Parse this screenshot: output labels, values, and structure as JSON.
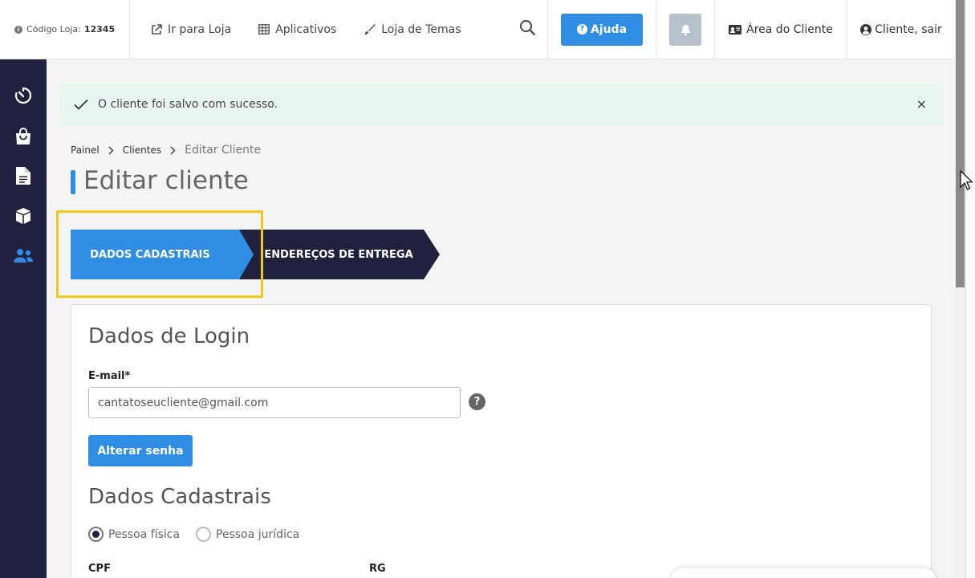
{
  "topbar": {
    "store_code_label": "Código Loja:",
    "store_code_value": "12345",
    "links": [
      {
        "label": "Ir para Loja",
        "icon": "external-link-icon"
      },
      {
        "label": "Aplicativos",
        "icon": "grid-icon"
      },
      {
        "label": "Loja de Temas",
        "icon": "brush-icon"
      }
    ],
    "help_label": "Ajuda",
    "client_area_label": "Área do Cliente",
    "user_label": "Cliente, sair"
  },
  "sidebar": {
    "items": [
      {
        "icon": "dashboard-gauge-icon",
        "active": false
      },
      {
        "icon": "shopping-bag-icon",
        "active": false
      },
      {
        "icon": "document-icon",
        "active": false
      },
      {
        "icon": "box-icon",
        "active": false
      },
      {
        "icon": "users-icon",
        "active": true
      }
    ]
  },
  "alert": {
    "message": "O cliente foi salvo com sucesso.",
    "close": "×"
  },
  "breadcrumb": {
    "items": [
      "Painel",
      "Clientes"
    ],
    "current": "Editar Cliente"
  },
  "page": {
    "title": "Editar cliente"
  },
  "steps": [
    {
      "label": "DADOS CADASTRAIS",
      "active": true
    },
    {
      "label": "ENDEREÇOS DE ENTREGA",
      "active": false
    }
  ],
  "form": {
    "login_section_title": "Dados de Login",
    "email_label": "E-mail*",
    "email_value": "cantatoseucliente@gmail.com",
    "help_symbol": "?",
    "change_password_label": "Alterar senha",
    "register_section_title": "Dados Cadastrais",
    "person_types": [
      {
        "label": "Pessoa física",
        "checked": true
      },
      {
        "label": "Pessoa jurídica",
        "checked": false
      }
    ],
    "cpf_label": "CPF",
    "rg_label": "RG"
  },
  "colors": {
    "primary": "#2f8de4",
    "sidebar": "#20203f",
    "highlight": "#f0c91a",
    "alert_bg": "#e9f6f0"
  }
}
